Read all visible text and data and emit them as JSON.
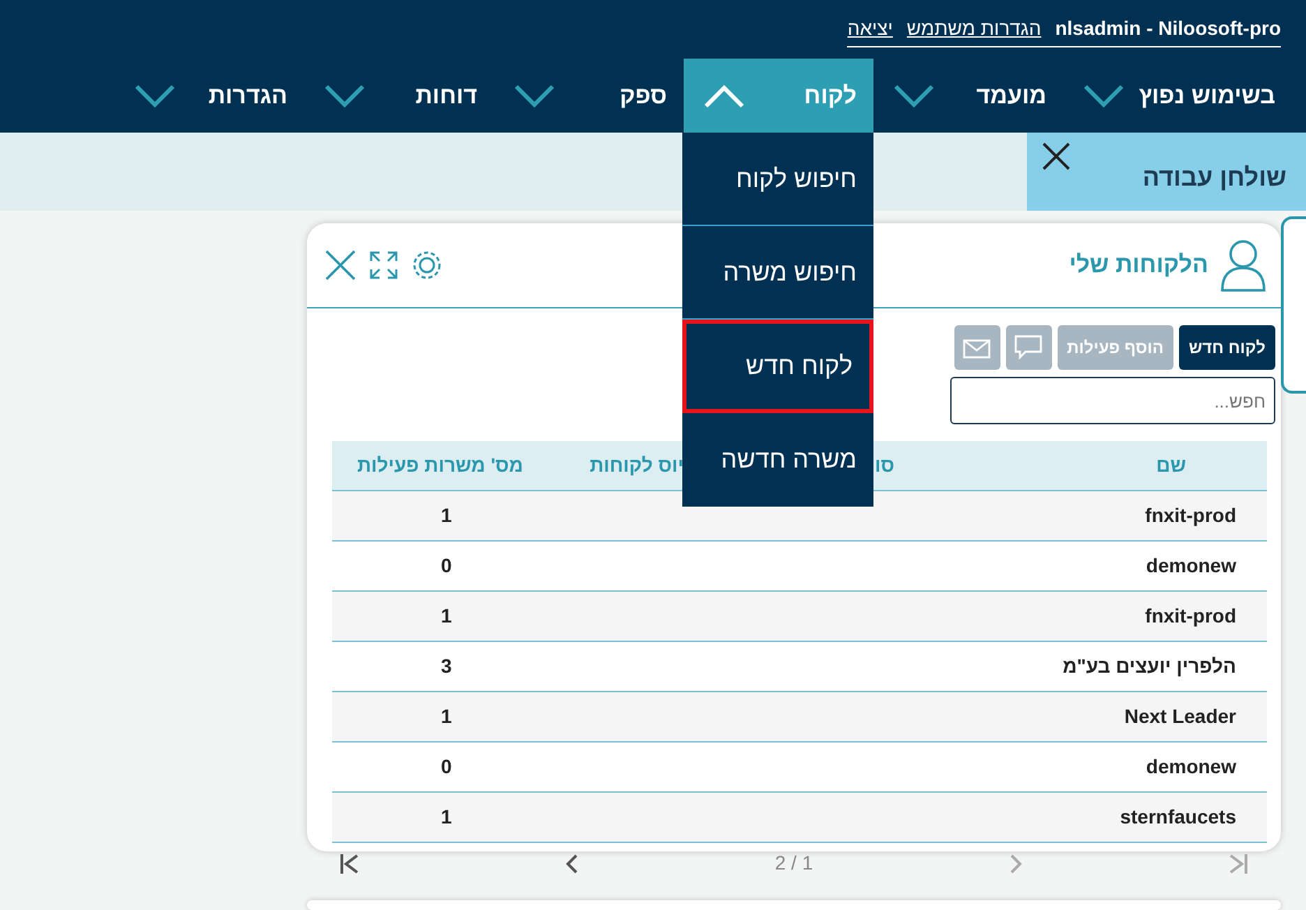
{
  "user_bar": {
    "account": "nlsadmin - Niloosoft-pro",
    "links": [
      "הגדרות משתמש",
      "יציאה"
    ]
  },
  "nav": [
    {
      "label": "בשימוש נפוץ",
      "expanded": false
    },
    {
      "label": "מועמד",
      "expanded": false
    },
    {
      "label": "לקוח",
      "expanded": true
    },
    {
      "label": "ספק",
      "expanded": false
    },
    {
      "label": "דוחות",
      "expanded": false
    },
    {
      "label": "הגדרות",
      "expanded": false
    }
  ],
  "dropdown": [
    {
      "label": "חיפוש לקוח",
      "highlighted": false
    },
    {
      "label": "חיפוש משרה",
      "highlighted": false
    },
    {
      "label": "לקוח חדש",
      "highlighted": true
    },
    {
      "label": "משרה חדשה",
      "highlighted": false
    }
  ],
  "workspace_tab": {
    "label": "שולחן עבודה"
  },
  "card": {
    "title": "הלקוחות שלי",
    "buttons": [
      {
        "kind": "text",
        "label": "לקוח חדש",
        "disabled": false
      },
      {
        "kind": "text",
        "label": "הוסף פעילות",
        "disabled": true
      },
      {
        "kind": "sms",
        "disabled": true
      },
      {
        "kind": "mail",
        "disabled": true
      }
    ],
    "search": {
      "placeholder": "חפש..."
    },
    "table": {
      "columns": [
        "שם",
        "סו",
        "יוס לקוחות",
        "מס' משרות פעילות"
      ],
      "rows": [
        [
          "fnxit-prod",
          "1"
        ],
        [
          "demonew",
          "0"
        ],
        [
          "fnxit-prod",
          "1"
        ],
        [
          "הלפרין יועצים בע\"מ",
          "3"
        ],
        [
          "Next Leader",
          "1"
        ],
        [
          "demonew",
          "0"
        ],
        [
          "sternfaucets",
          "1"
        ]
      ]
    },
    "pager": {
      "text": "2 / 1",
      "prev_enabled": true,
      "next_enabled": false
    }
  }
}
